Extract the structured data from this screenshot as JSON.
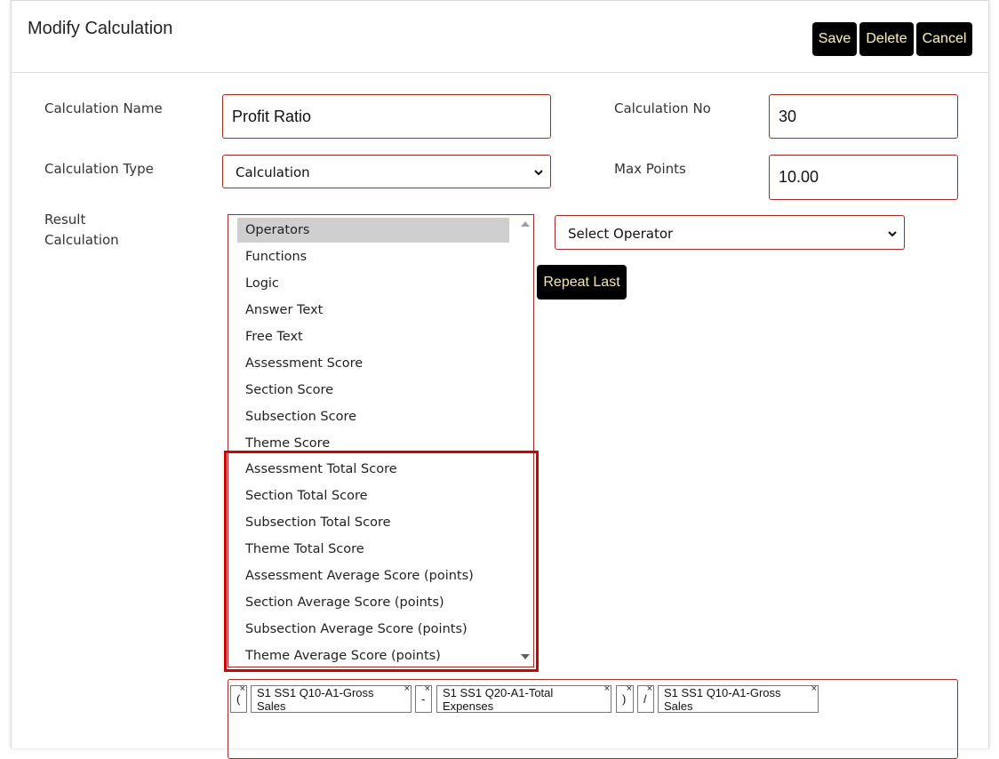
{
  "header": {
    "title": "Modify Calculation",
    "buttons": {
      "save": "Save",
      "delete": "Delete",
      "cancel": "Cancel"
    }
  },
  "form": {
    "calculation_name": {
      "label": "Calculation Name",
      "value": "Profit Ratio"
    },
    "calculation_no": {
      "label": "Calculation No",
      "value": "30"
    },
    "calculation_type": {
      "label": "Calculation Type",
      "value": "Calculation"
    },
    "max_points": {
      "label": "Max Points",
      "value": "10.00"
    },
    "result_calculation": {
      "label_line1": "Result",
      "label_line2": "Calculation"
    }
  },
  "category_list": {
    "selected": "Operators",
    "options": [
      "Operators",
      "Functions",
      "Logic",
      "Answer Text",
      "Free Text",
      "Assessment Score",
      "Section Score",
      "Subsection Score",
      "Theme Score",
      "Assessment Total Score",
      "Section Total Score",
      "Subsection Total Score",
      "Theme Total Score",
      "Assessment Average Score (points)",
      "Section Average Score (points)",
      "Subsection Average Score (points)",
      "Theme Average Score (points)"
    ]
  },
  "operator_select": {
    "value": "Select Operator"
  },
  "repeat_last_label": "Repeat Last",
  "expression": {
    "tokens": [
      {
        "text": "(",
        "remove": "×"
      },
      {
        "text": "S1 SS1 Q10-A1-Gross Sales",
        "remove": "×"
      },
      {
        "text": "-",
        "remove": "×"
      },
      {
        "text": "S1 SS1 Q20-A1-Total Expenses",
        "remove": "×"
      },
      {
        "text": ")",
        "remove": "×"
      },
      {
        "text": "/",
        "remove": "×"
      },
      {
        "text": "S1 SS1 Q10-A1-Gross Sales",
        "remove": "×"
      }
    ]
  },
  "colors": {
    "field_border": "#a52a2a",
    "button_bg": "#000000",
    "button_text": "#f3e9a8",
    "highlight": "#d00000",
    "selected_option": "#cfcfcf"
  },
  "icons": [
    "chevron-down-icon",
    "scroll-up-arrow-icon",
    "scroll-down-arrow-icon",
    "remove-token-icon"
  ]
}
